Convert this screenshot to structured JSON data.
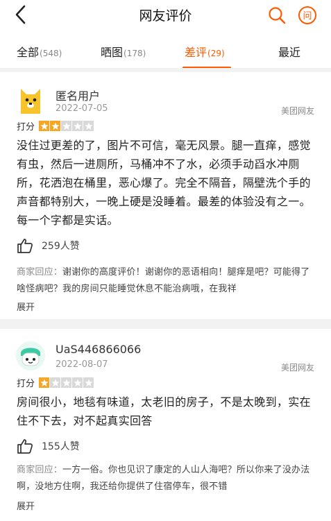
{
  "header": {
    "title": "网友评价"
  },
  "tabs": [
    {
      "label": "全部",
      "count": "(548)"
    },
    {
      "label": "晒图",
      "count": "(178)"
    },
    {
      "label": "差评",
      "count": "(29)"
    },
    {
      "label": "最近",
      "count": ""
    }
  ],
  "active_tab_index": 2,
  "colors": {
    "accent": "#ff5a00",
    "star_on": "#f5a623",
    "star_off": "#d9d9d9"
  },
  "reviews": [
    {
      "username": "匿名用户",
      "date": "2022-07-05",
      "source": "美团网友",
      "rating_label": "打分",
      "rating": 2,
      "rating_max": 5,
      "content": "没住过更差的了，图片不可信，毫无风景。腿一直痒，感觉有虫，然后一进厕所，马桶冲不了水，必须手动舀水冲厕所，花洒泡在桶里，恶心爆了。完全不隔音，隔壁洗个手的声音都特别大，一晚上硬是没睡着。最差的体验没有之一。每一个字都是实话。",
      "likes": "259人赞",
      "reply_label": "商家回应：",
      "reply": "谢谢你的高度评价！谢谢你的恶语相向！腿痒是吧？可能得了啥怪病吧？我的房间只能睡觉休息不能治病哦，在我祥",
      "expand": "展开",
      "avatar_icon": "yellow-cartoon-avatar-icon"
    },
    {
      "username": "UaS446866066",
      "date": "2022-08-07",
      "source": "美团网友",
      "rating_label": "打分",
      "rating": 1,
      "rating_max": 5,
      "content": "房间很小，地毯有味道，太老旧的房子，不是太晚到，实在住不下去，对不起真实回答",
      "likes": "155人赞",
      "reply_label": "商家回应：",
      "reply": "一方一俗。你也见识了康定的人山人海吧？所以你来了没办法啊，没地方住啊，我还给你提供了住宿停车，很不错",
      "expand": "展开",
      "avatar_icon": "green-cartoon-avatar-icon"
    }
  ]
}
